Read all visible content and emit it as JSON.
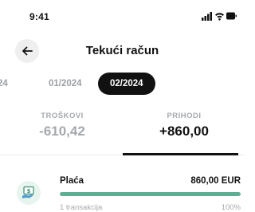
{
  "status_bar": {
    "time": "9:41",
    "icons": [
      "signal-icon",
      "wifi-icon",
      "battery-icon"
    ]
  },
  "header": {
    "title": "Tekući račun",
    "back_icon": "arrow-left-icon"
  },
  "months": {
    "items": [
      "24",
      "01/2024",
      "02/2024"
    ],
    "selected": "02/2024"
  },
  "summary": {
    "expenses_label": "TROŠKOVI",
    "expenses_amount": "-610,42",
    "income_label": "PRIHODI",
    "income_amount": "+860,00",
    "active_tab": "PRIHODI"
  },
  "categories": [
    {
      "name": "Plaća",
      "amount": "860,00 EUR",
      "subtitle": "1 transakcija",
      "percent_label": "100%",
      "progress": 1.0,
      "icon": "salary-cash-icon",
      "color": "#5fae93"
    }
  ],
  "colors": {
    "accent_dark": "#111111",
    "muted": "#a5a9ae",
    "progress_green": "#5fae93",
    "icon_bg": "#e8f5ef"
  }
}
